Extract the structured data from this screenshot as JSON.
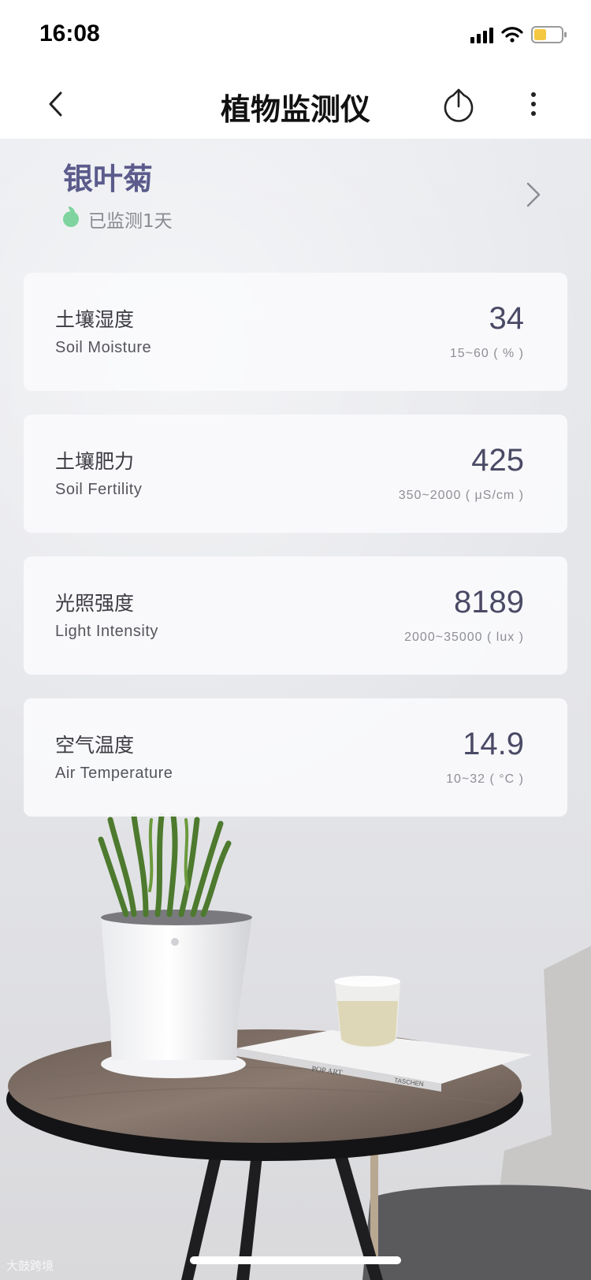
{
  "status_bar": {
    "time": "16:08",
    "battery_color": "#f5c842"
  },
  "nav": {
    "title": "植物监测仪",
    "back_icon": "chevron-left-icon",
    "share_icon": "share-icon",
    "more_icon": "more-vertical-icon"
  },
  "plant": {
    "name": "银叶菊",
    "monitor_status": "已监测1天",
    "status_color": "#7fd39e"
  },
  "metrics": [
    {
      "cn": "土壤湿度",
      "en": "Soil Moisture",
      "value": "34",
      "range": "15~60 ( % )"
    },
    {
      "cn": "土壤肥力",
      "en": "Soil Fertility",
      "value": "425",
      "range": "350~2000 ( μS/cm )"
    },
    {
      "cn": "光照强度",
      "en": "Light Intensity",
      "value": "8189",
      "range": "2000~35000 ( lux )"
    },
    {
      "cn": "空气温度",
      "en": "Air Temperature",
      "value": "14.9",
      "range": "10~32 ( °C )"
    }
  ],
  "background": {
    "book_title": "POP ART",
    "book_publisher": "TASCHEN"
  },
  "watermark": "大鼓跨境",
  "colors": {
    "accent": "#5b5b8c",
    "value": "#4a4a66"
  }
}
